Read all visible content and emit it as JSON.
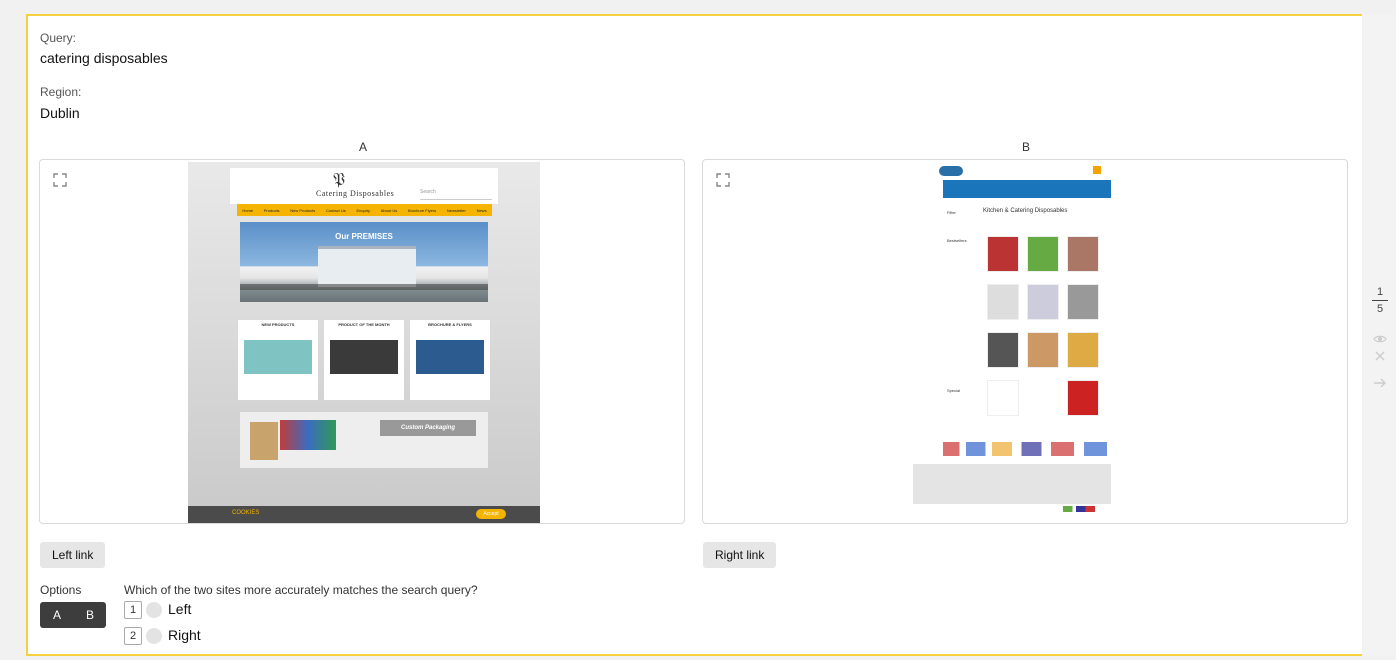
{
  "query": {
    "label": "Query:",
    "value": "catering disposables"
  },
  "region": {
    "label": "Region:",
    "value": "Dublin"
  },
  "columns": {
    "a": "A",
    "b": "B"
  },
  "site_a": {
    "brand": "Catering Disposables",
    "search_placeholder": "Search",
    "nav": [
      "Home",
      "Products",
      "New Products",
      "Contact Us",
      "Enquiry",
      "About Us",
      "Brochure Flyers",
      "Newsletter",
      "News"
    ],
    "banner": "Our PREMISES",
    "sections": [
      "NEW PRODUCTS",
      "PRODUCT OF THE MONTH",
      "BROCHURE & FLYERS"
    ],
    "custom_packaging": "Custom Packaging",
    "cookies": "COOKIES",
    "accept": "Accept"
  },
  "site_b": {
    "page_title": "Kitchen & Catering Disposables",
    "filter": "Filter",
    "bestsellers": "Bestsellers",
    "special": "Special"
  },
  "buttons": {
    "left": "Left link",
    "right": "Right link"
  },
  "options": {
    "label": "Options",
    "toggle_a": "A",
    "toggle_b": "B"
  },
  "question": "Which of the two sites more accurately matches the search query?",
  "answers": [
    {
      "key": "1",
      "label": "Left"
    },
    {
      "key": "2",
      "label": "Right"
    }
  ],
  "counter": {
    "current": "1",
    "total": "5"
  },
  "colors": {
    "accent": "#f6d13e",
    "site_a_nav": "#f4b400",
    "site_b_nav": "#1a75bb"
  }
}
